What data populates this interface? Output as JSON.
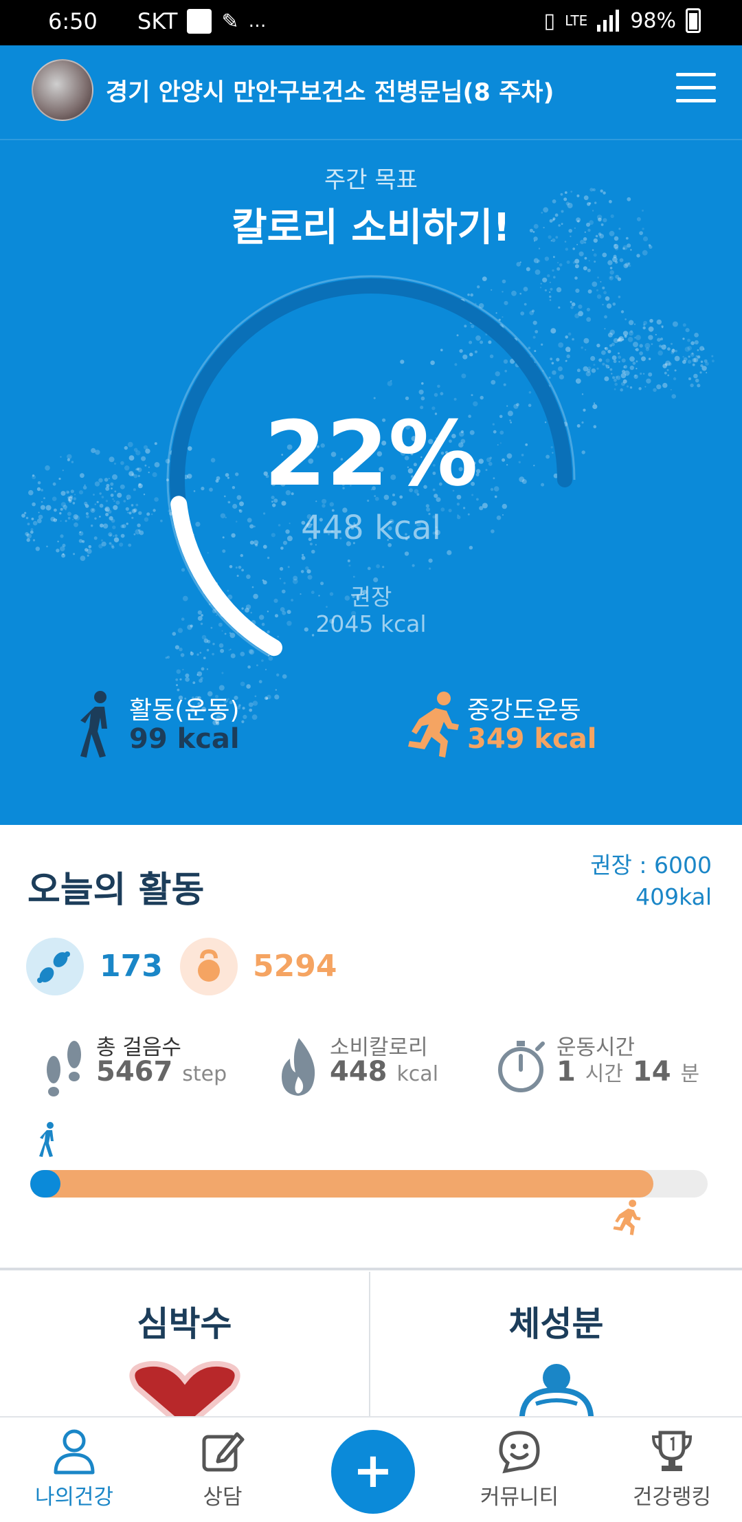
{
  "status_bar": {
    "time": "6:50",
    "carrier": "SKT",
    "dots": "…",
    "battery": "98%"
  },
  "header": {
    "title": "경기 안양시 만안구보건소 전병문님(8 주차)"
  },
  "hero": {
    "goal_subtitle": "주간 목표",
    "goal_title": "칼로리 소비하기!",
    "percent": "22%",
    "progress_value": 22,
    "consumed": "448 kcal",
    "recommended_label": "권장",
    "recommended_value": "2045 kcal",
    "activity": {
      "label": "활동(운동)",
      "value": "99 kcal"
    },
    "moderate": {
      "label": "중강도운동",
      "value": "349 kcal"
    }
  },
  "today": {
    "title": "오늘의 활동",
    "recommended_line1": "권장 : 6000",
    "recommended_line2": "409kal",
    "badge_steps": "173",
    "badge_weight": "5294",
    "total_steps": {
      "label": "총 걸음수",
      "value": "5467",
      "unit": "step"
    },
    "calories": {
      "label": "소비칼로리",
      "value": "448",
      "unit": "kcal"
    },
    "exercise_time": {
      "label": "운동시간",
      "hours": "1",
      "hours_unit": "시간",
      "minutes": "14",
      "minutes_unit": "분"
    },
    "bar": {
      "walking_fraction": 0.045,
      "running_fraction": 0.92
    }
  },
  "cards": {
    "heart_rate": "심박수",
    "body_composition": "체성분"
  },
  "bottom_nav": {
    "items": [
      {
        "label": "나의건강",
        "active": true
      },
      {
        "label": "상담"
      },
      {
        "label": "+"
      },
      {
        "label": "커뮤니티"
      },
      {
        "label": "건강랭킹"
      }
    ]
  },
  "colors": {
    "primary": "#0b8ad9",
    "dark_text": "#1c3d5a",
    "orange": "#f5a462",
    "accent_blue": "#1a86c7"
  }
}
